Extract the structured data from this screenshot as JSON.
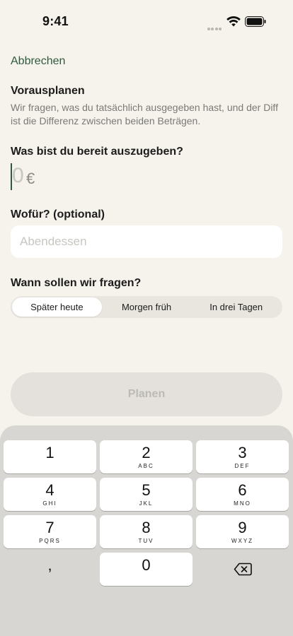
{
  "status_bar": {
    "time": "9:41",
    "icons": [
      "signal-dots-icon",
      "wifi-icon",
      "battery-icon"
    ]
  },
  "header": {
    "cancel_label": "Abbrechen",
    "title": "Vorausplanen",
    "description": "Wir fragen, was du tatsächlich ausgegeben hast, und der Diff ist die Differenz zwischen beiden Beträgen."
  },
  "amount": {
    "label": "Was bist du bereit auszugeben?",
    "value": "0",
    "currency": "€"
  },
  "purpose": {
    "label": "Wofür? (optional)",
    "value": "",
    "placeholder": "Abendessen"
  },
  "when": {
    "label": "Wann sollen wir fragen?",
    "options": [
      "Später heute",
      "Morgen früh",
      "In drei Tagen"
    ],
    "selected": "Später heute"
  },
  "primary_button": {
    "label": "Planen",
    "enabled": false
  },
  "keypad": {
    "keys": [
      {
        "digit": "1",
        "letters": ""
      },
      {
        "digit": "2",
        "letters": "ABC"
      },
      {
        "digit": "3",
        "letters": "DEF"
      },
      {
        "digit": "4",
        "letters": "GHI"
      },
      {
        "digit": "5",
        "letters": "JKL"
      },
      {
        "digit": "6",
        "letters": "MNO"
      },
      {
        "digit": "7",
        "letters": "PQRS"
      },
      {
        "digit": "8",
        "letters": "TUV"
      },
      {
        "digit": "9",
        "letters": "WXYZ"
      },
      {
        "digit": ",",
        "letters": ""
      },
      {
        "digit": "0",
        "letters": ""
      }
    ],
    "delete_icon": "delete-backspace-icon"
  },
  "colors": {
    "background": "#f6f2ec",
    "accent": "#2e5b3e",
    "keyboard": "#d8d6d2"
  }
}
